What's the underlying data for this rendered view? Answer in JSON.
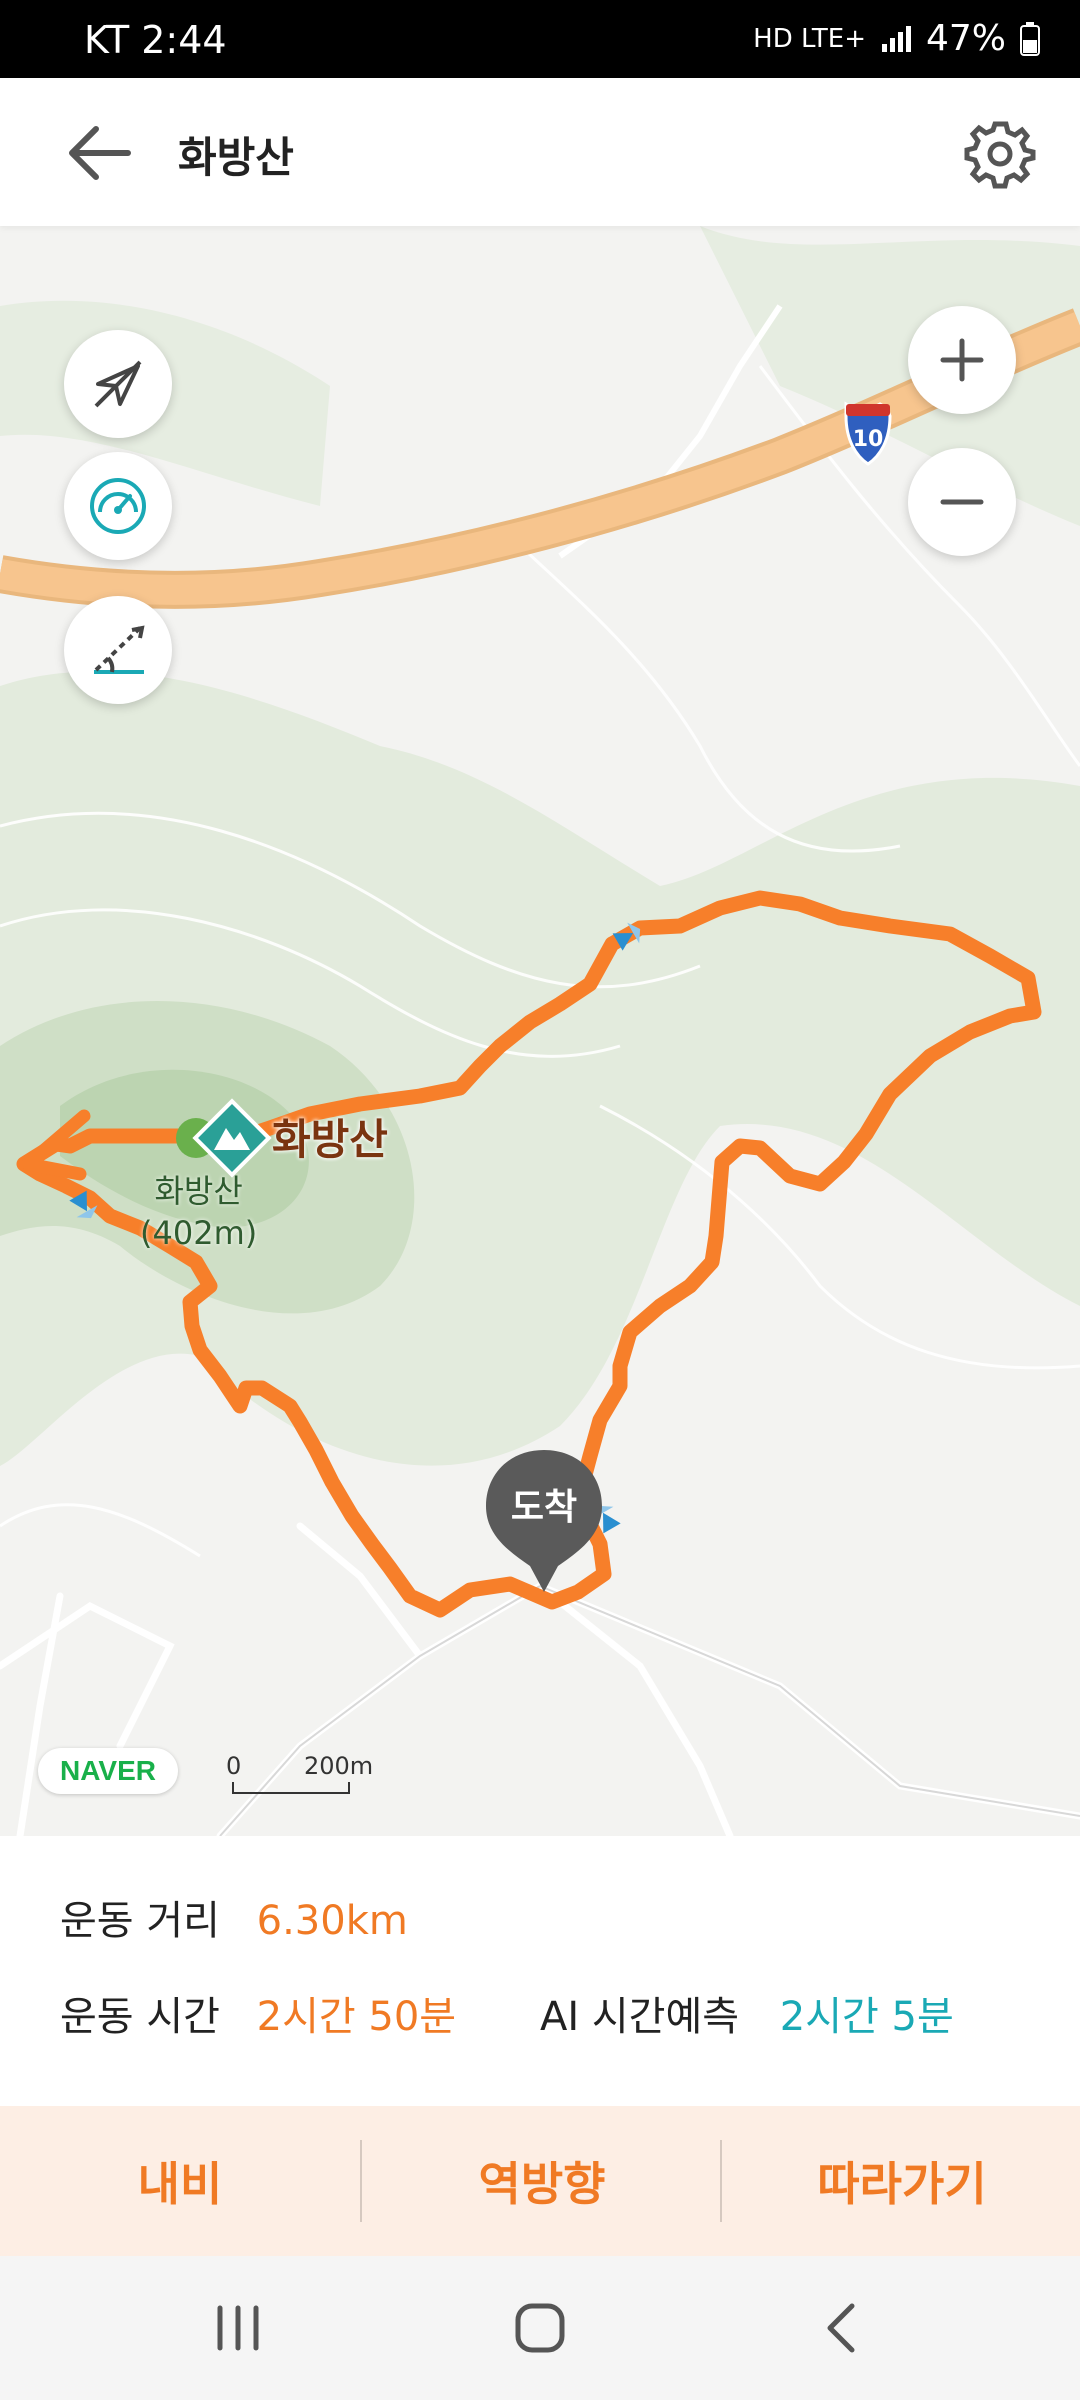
{
  "status_bar": {
    "carrier_time": "KT 2:44",
    "network": "HD LTE+",
    "battery": "47%"
  },
  "header": {
    "title": "화방산",
    "back_icon": "arrow-left-icon",
    "settings_icon": "gear-icon"
  },
  "map": {
    "controls_left": [
      "compass-off-icon",
      "speedometer-icon",
      "slope-angle-icon"
    ],
    "controls_right": [
      "plus-icon",
      "minus-icon"
    ],
    "highway_shield": "10",
    "peak_name": "화방산",
    "peak_sub_name": "화방산",
    "peak_elevation": "(402m)",
    "arrival_marker": "도착",
    "naver_logo": "NAVER",
    "scale_zero": "0",
    "scale_distance": "200m",
    "route_color": "#f77f2a"
  },
  "stats": {
    "distance_label": "운동 거리",
    "distance_value": "6.30km",
    "time_label": "운동 시간",
    "time_value": "2시간 50분",
    "ai_label": "AI 시간예측",
    "ai_value": "2시간 5분"
  },
  "actions": {
    "navigate": "내비",
    "reverse": "역방향",
    "follow": "따라가기"
  },
  "colors": {
    "accent_orange": "#f07a24",
    "accent_teal": "#1aa9b5"
  },
  "system_nav": [
    "recent-apps-icon",
    "home-icon",
    "back-icon"
  ]
}
